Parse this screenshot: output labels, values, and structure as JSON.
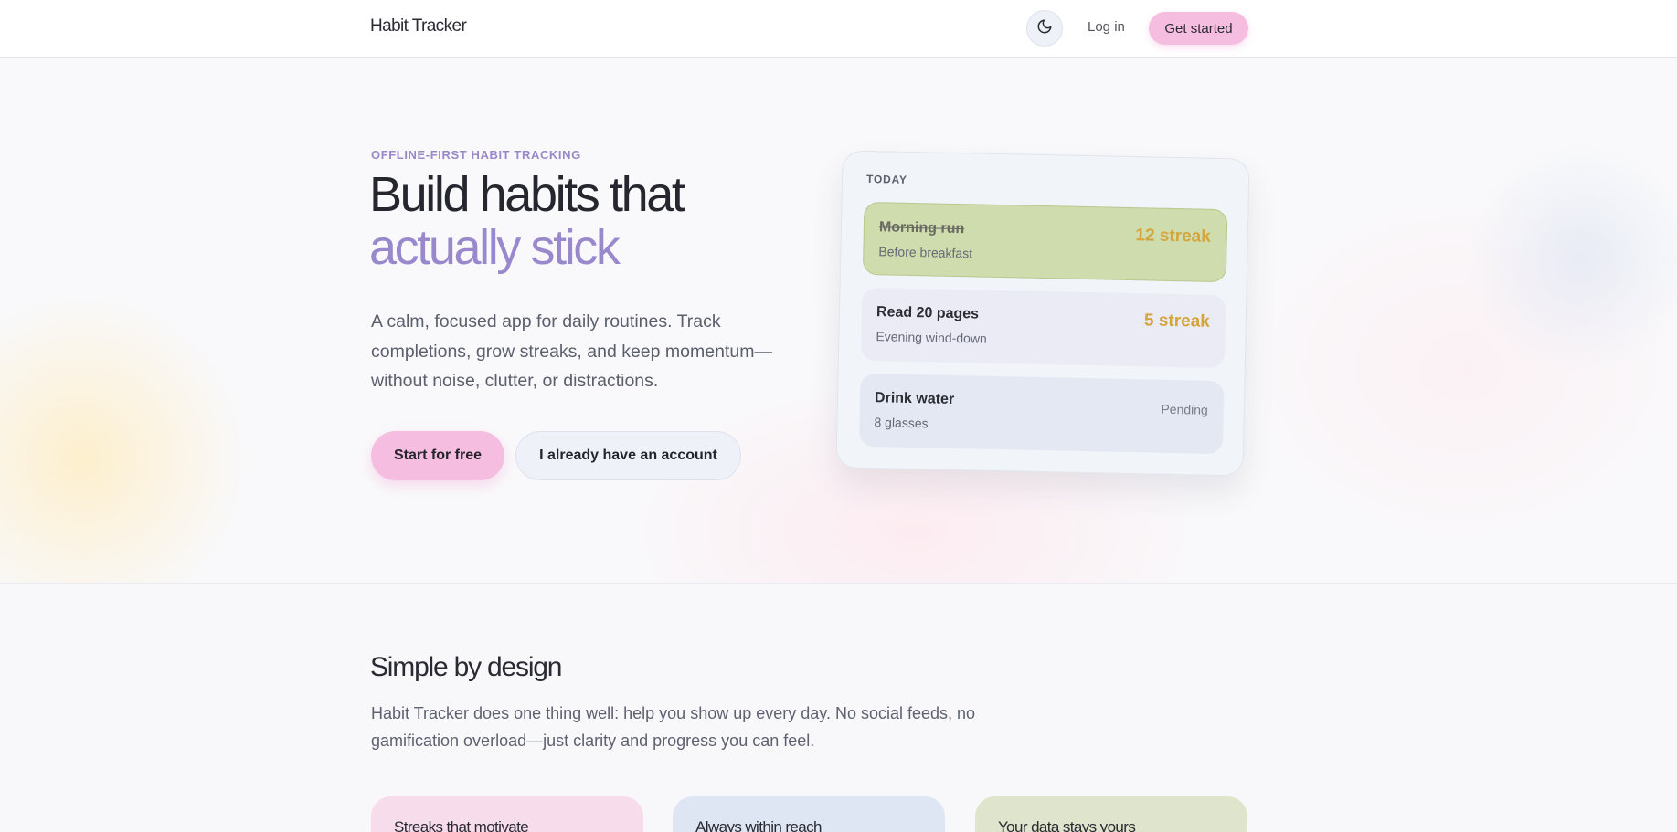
{
  "header": {
    "brand": "Habit Tracker",
    "theme_toggle_icon": "moon-icon",
    "login_label": "Log in",
    "get_started_label": "Get started"
  },
  "hero": {
    "eyebrow": "OFFLINE-FIRST HABIT TRACKING",
    "title_line1": "Build habits that",
    "title_line2": "actually stick",
    "lead": "A calm, focused app for daily routines. Track completions, grow streaks, and keep momentum—without noise, clutter, or distractions.",
    "primary_cta": "Start for free",
    "secondary_cta": "I already have an account",
    "accent_color": "#9a88cc",
    "cta_color": "#f5bde0"
  },
  "today_card": {
    "label": "TODAY",
    "habits": [
      {
        "title": "Morning run",
        "subtitle": "Before breakfast",
        "status": "12 streak",
        "done": true,
        "color": "#cfdcae"
      },
      {
        "title": "Read 20 pages",
        "subtitle": "Evening wind-down",
        "status": "5 streak",
        "done": false,
        "color": "#ebebf6"
      },
      {
        "title": "Drink water",
        "subtitle": "8 glasses",
        "status": "Pending",
        "done": false,
        "color": "#e3e8f3"
      }
    ],
    "streak_color": "#d4a53a"
  },
  "design_section": {
    "title": "Simple by design",
    "description": "Habit Tracker does one thing well: help you show up every day. No social feeds, no gamification overload—just clarity and progress you can feel.",
    "features": [
      {
        "title": "Streaks that motivate",
        "color": "#f7dcec"
      },
      {
        "title": "Always within reach",
        "color": "#dfe6f3"
      },
      {
        "title": "Your data stays yours",
        "color": "#dfe5cc"
      }
    ]
  }
}
